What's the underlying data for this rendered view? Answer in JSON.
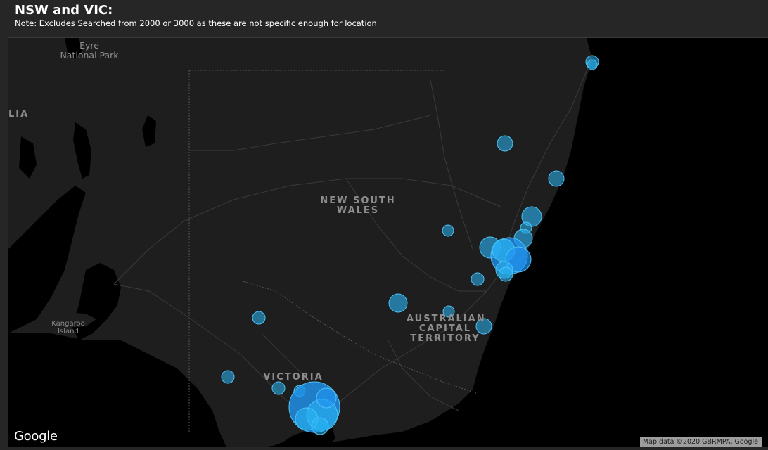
{
  "header": {
    "title": "NSW and VIC:",
    "note": "Note: Excludes Searched from 2000 or 3000 as these are not specific enough for location"
  },
  "map": {
    "labels": {
      "park_line1": "Eyre",
      "park_line2": "National Park",
      "sa_fragment": "LIA",
      "nsw_line1": "NEW SOUTH",
      "nsw_line2": "WALES",
      "act_line1": "AUSTRALIAN",
      "act_line2": "CAPITAL",
      "act_line3": "TERRITORY",
      "victoria": "VICTORIA",
      "kangaroo_line1": "Kangaroo",
      "kangaroo_line2": "Island"
    },
    "google_logo": "Google",
    "attribution": "Map data ©2020 GBRMPA, Google",
    "colors": {
      "land": "#1e1e1e",
      "water": "#000000",
      "bubble": "#29b6f6"
    }
  }
}
